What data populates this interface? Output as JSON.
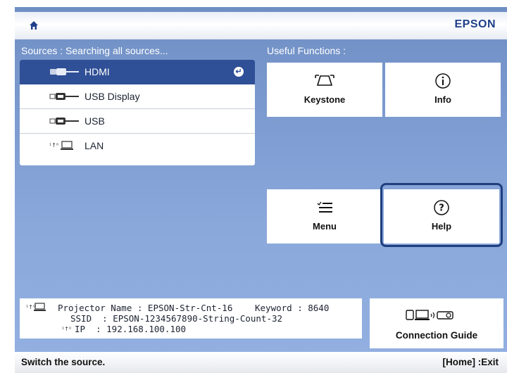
{
  "brand": "EPSON",
  "sources_heading": "Sources : Searching all sources...",
  "useful_heading": "Useful Functions :",
  "sources": [
    {
      "label": "HDMI",
      "icon": "hdmi-icon",
      "selected": true
    },
    {
      "label": "USB Display",
      "icon": "usb-display-icon",
      "selected": false
    },
    {
      "label": "USB",
      "icon": "usb-icon",
      "selected": false
    },
    {
      "label": "LAN",
      "icon": "lan-icon",
      "selected": false
    }
  ],
  "functions": {
    "keystone": "Keystone",
    "info": "Info",
    "menu": "Menu",
    "help": "Help"
  },
  "network": {
    "projector_name_label": "Projector Name : EPSON-Str-Cnt-16",
    "keyword_label": "Keyword : 8640",
    "ssid_label": "SSID  : EPSON-1234567890-String-Count-32",
    "ip_label": "IP  : 192.168.100.100"
  },
  "connection_guide": "Connection Guide",
  "status": {
    "hint": "Switch the source.",
    "exit": "[Home] :Exit"
  },
  "colors": {
    "selected": "#2f4f96",
    "highlight_border": "#1f3f7f",
    "brand": "#1e3f8a"
  }
}
